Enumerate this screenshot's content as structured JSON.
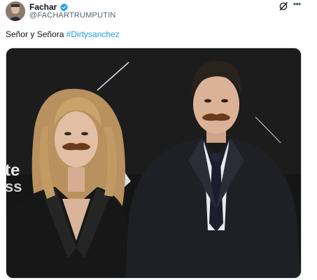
{
  "post": {
    "display_name": "Fachar",
    "handle": "@FACHARTRUMPUTIN",
    "text_prefix": "Señor y Señora ",
    "hashtag": "#Dirtysanchez"
  },
  "icons": {
    "verified": "verified-badge-icon",
    "grok": "grok-icon",
    "more": "more-options-icon"
  },
  "media": {
    "backdrop_text_1": "te",
    "backdrop_text_2": "ss"
  },
  "colors": {
    "link": "#1d9bf0",
    "secondary_text": "#536471",
    "verified": "#1d9bf0"
  }
}
